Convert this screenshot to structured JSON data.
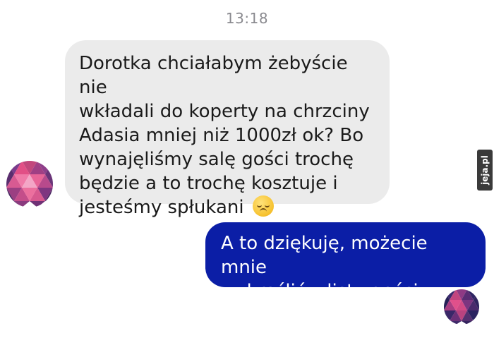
{
  "conversation": {
    "timestamp": "13:18",
    "incoming_message": {
      "text": "Dorotka chciałabym żebyście nie\nwkładali do koperty na chrzciny\nAdasia mniej niż 1000zł ok? Bo\nwynajęliśmy salę gości trochę\nbędzie a to trochę kosztuje i\njesteśmy spłukani",
      "emoji": "pensive-face-emoji",
      "bubble_color": "#ebebeb"
    },
    "outgoing_message": {
      "text": "A to dziękuję, możecie mnie\nwykreślić z listy gości.",
      "bubble_color": "#0b1ea6"
    }
  },
  "watermark": {
    "text": "jeja.pl"
  }
}
